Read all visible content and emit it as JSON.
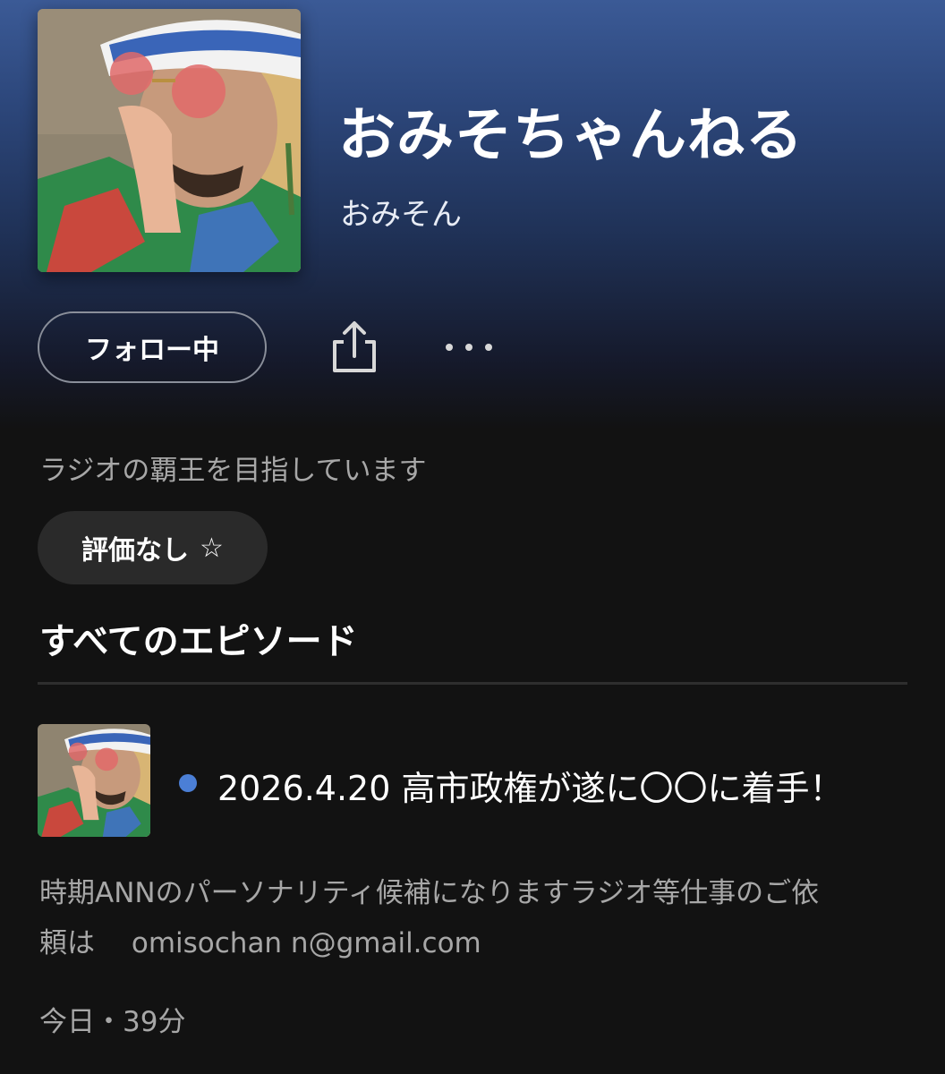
{
  "show": {
    "title": "おみそちゃんねる",
    "author": "おみそん",
    "description": "ラジオの覇王を目指しています"
  },
  "actions": {
    "follow_label": "フォロー中",
    "share_icon": "share-icon",
    "more_icon": "more-horizontal-icon"
  },
  "rating": {
    "label": "評価なし",
    "icon": "☆"
  },
  "episodes_section": {
    "title": "すべてのエピソード"
  },
  "episode": {
    "title": "2026.4.20 高市政権が遂に〇〇に着手！",
    "description_line1": "時期ANNのパーソナリティ候補になりますラジオ等仕事のご依",
    "description_line2": "頼は　 omisochan n@gmail.com",
    "meta": "今日・39分",
    "unplayed_dot_color": "#4b7fd6"
  },
  "colors": {
    "header_gradient_top": "#3b5a96",
    "background": "#121212",
    "secondary_text": "#a7a7a7"
  }
}
